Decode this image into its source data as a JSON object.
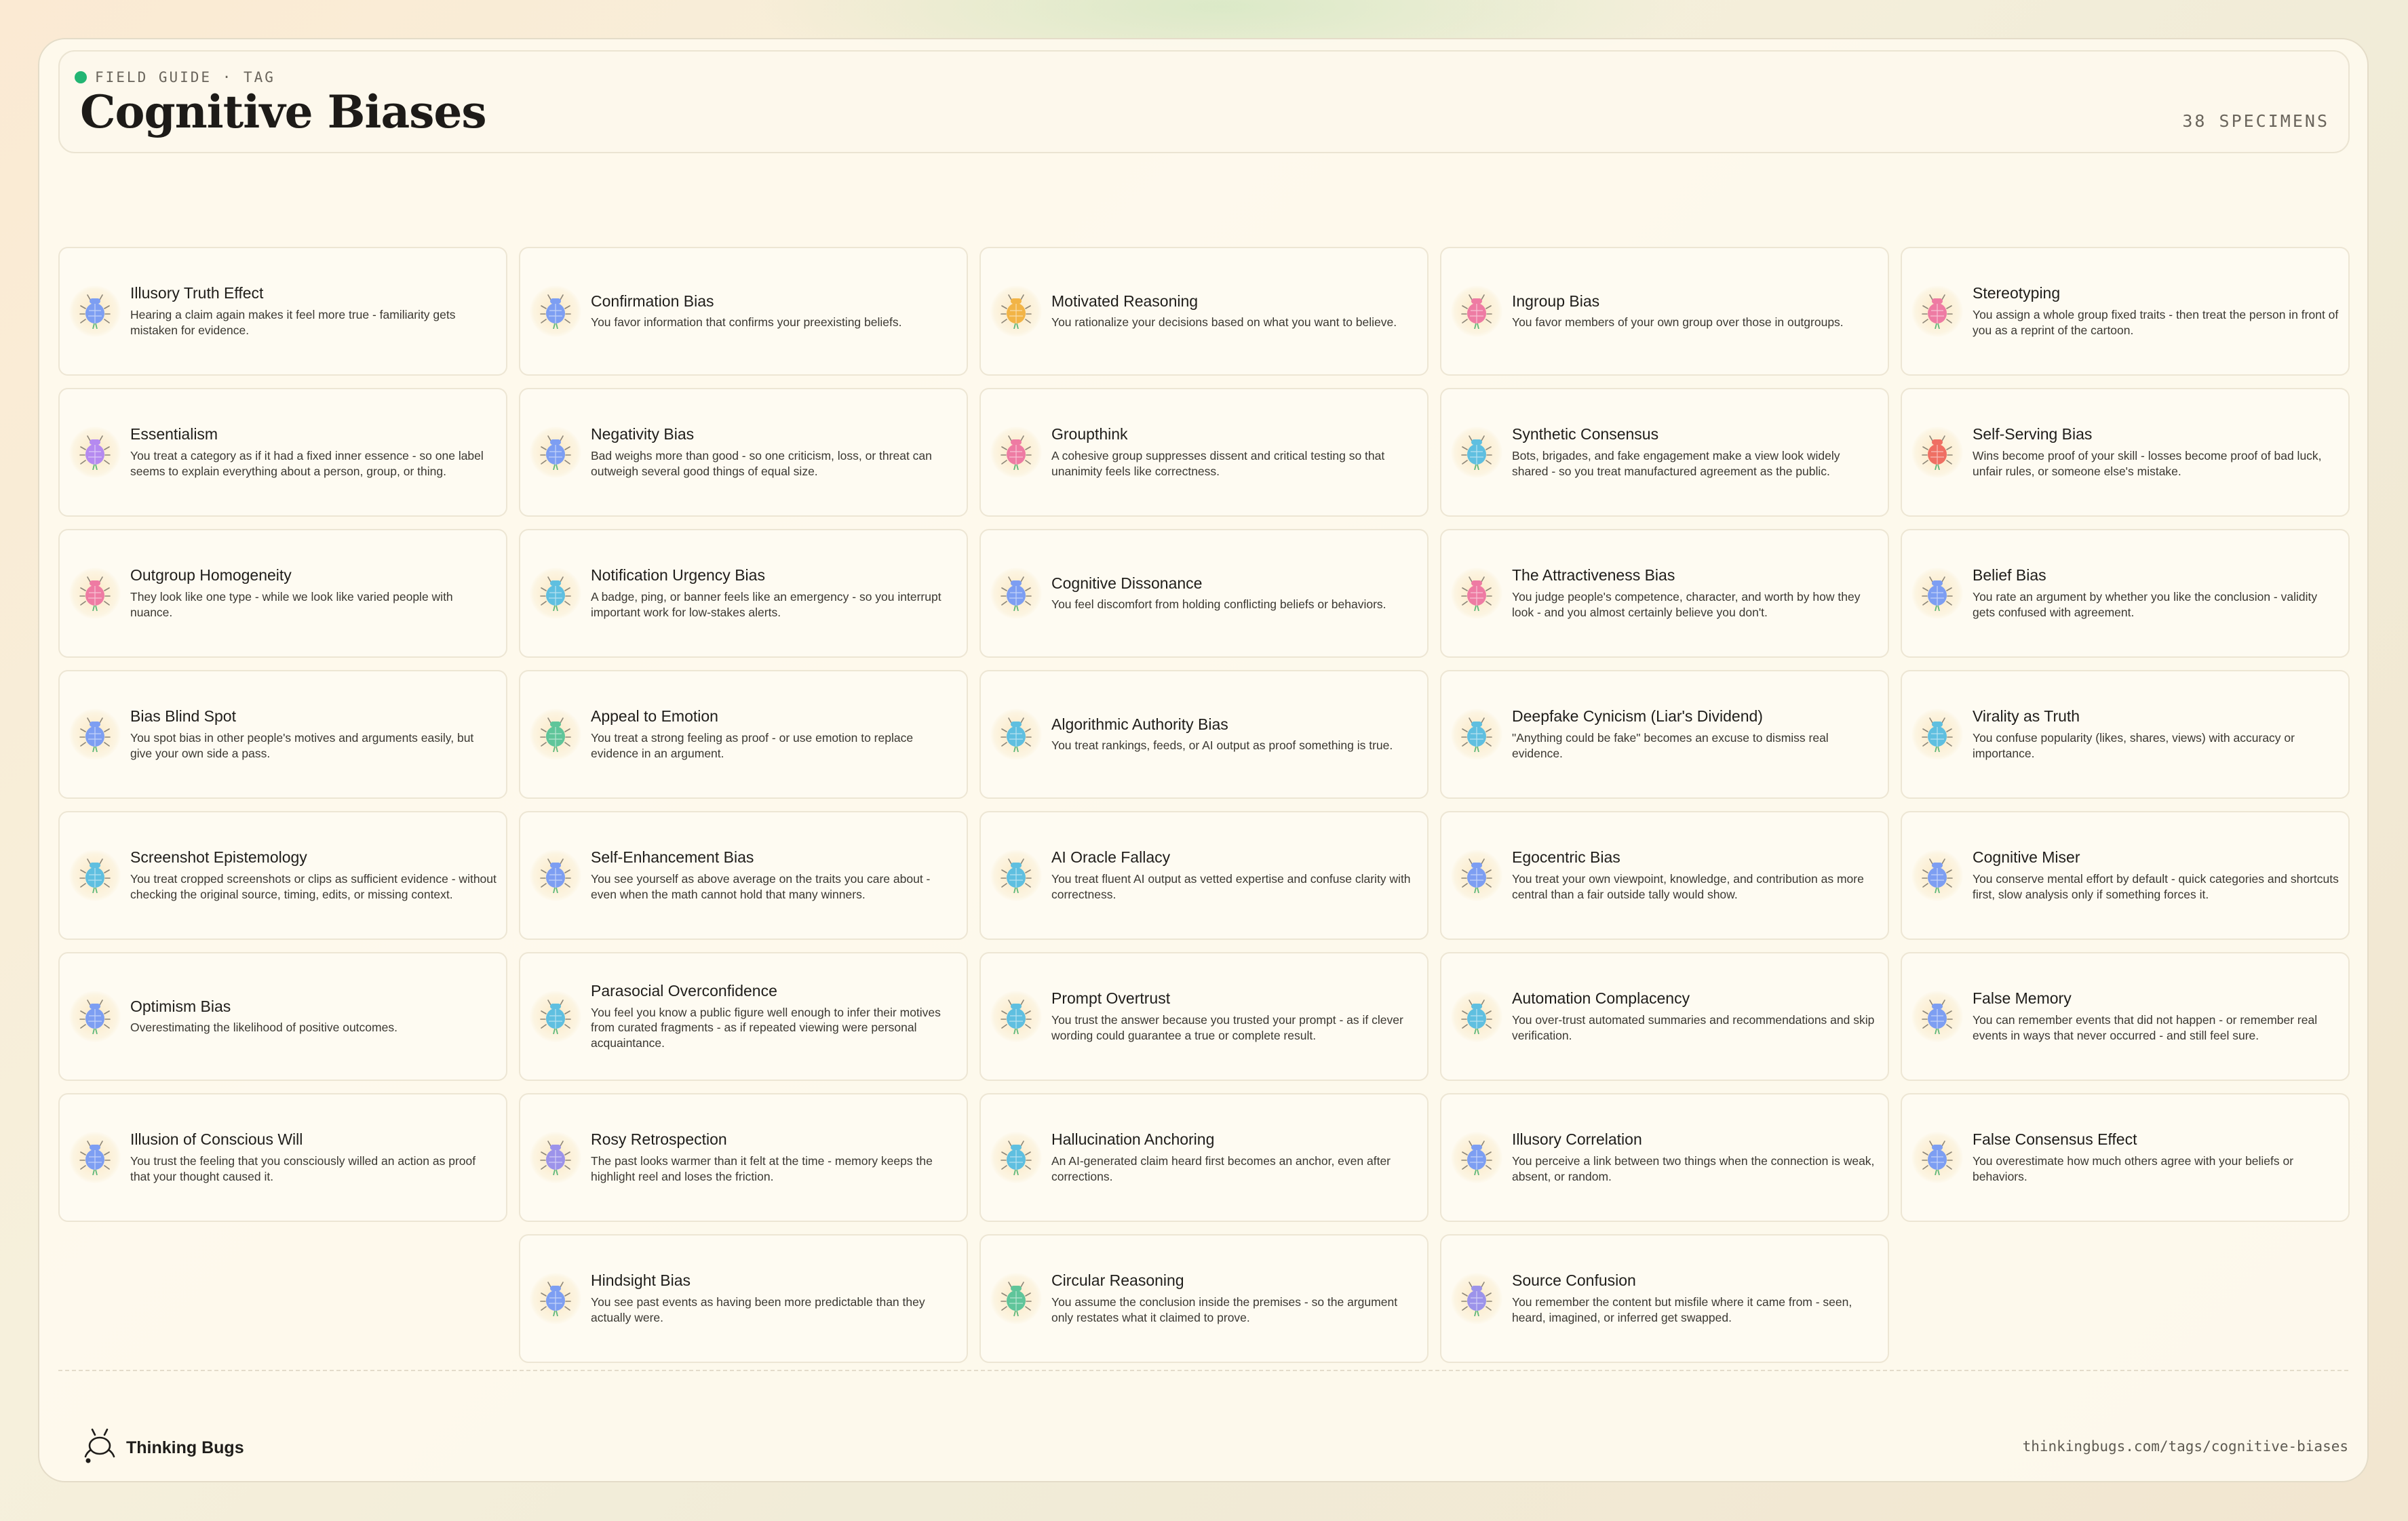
{
  "header": {
    "eyebrow": "FIELD GUIDE · TAG",
    "title": "Cognitive Biases",
    "count": "38 SPECIMENS"
  },
  "icons": {
    "status-dot": "green-dot-icon",
    "bug": "bug-icon",
    "logo": "bug-logo-icon"
  },
  "colors": {
    "status_dot": "#22b573",
    "bug_palette": {
      "blue": "#7d9ef2",
      "orange": "#f2b446",
      "pink": "#ee7ba3",
      "purple": "#b58af0",
      "cyan": "#5fbfe0",
      "red": "#ef6f63",
      "green": "#5fc59a",
      "violet": "#9c93ea"
    }
  },
  "cards": [
    {
      "title": "Illusory Truth Effect",
      "desc": "Hearing a claim again makes it feel more true - familiarity gets mistaken for evidence.",
      "color": "blue"
    },
    {
      "title": "Confirmation Bias",
      "desc": "You favor information that confirms your preexisting beliefs.",
      "color": "blue"
    },
    {
      "title": "Motivated Reasoning",
      "desc": "You rationalize your decisions based on what you want to believe.",
      "color": "orange"
    },
    {
      "title": "Ingroup Bias",
      "desc": "You favor members of your own group over those in outgroups.",
      "color": "pink"
    },
    {
      "title": "Stereotyping",
      "desc": "You assign a whole group fixed traits - then treat the person in front of you as a reprint of the cartoon.",
      "color": "pink"
    },
    {
      "title": "Essentialism",
      "desc": "You treat a category as if it had a fixed inner essence - so one label seems to explain everything about a person, group, or thing.",
      "color": "purple"
    },
    {
      "title": "Negativity Bias",
      "desc": "Bad weighs more than good - so one criticism, loss, or threat can outweigh several good things of equal size.",
      "color": "blue"
    },
    {
      "title": "Groupthink",
      "desc": "A cohesive group suppresses dissent and critical testing so that unanimity feels like correctness.",
      "color": "pink"
    },
    {
      "title": "Synthetic Consensus",
      "desc": "Bots, brigades, and fake engagement make a view look widely shared - so you treat manufactured agreement as the public.",
      "color": "cyan"
    },
    {
      "title": "Self-Serving Bias",
      "desc": "Wins become proof of your skill - losses become proof of bad luck, unfair rules, or someone else's mistake.",
      "color": "red"
    },
    {
      "title": "Outgroup Homogeneity",
      "desc": "They look like one type - while we look like varied people with nuance.",
      "color": "pink"
    },
    {
      "title": "Notification Urgency Bias",
      "desc": "A badge, ping, or banner feels like an emergency - so you interrupt important work for low-stakes alerts.",
      "color": "cyan"
    },
    {
      "title": "Cognitive Dissonance",
      "desc": "You feel discomfort from holding conflicting beliefs or behaviors.",
      "color": "blue"
    },
    {
      "title": "The Attractiveness Bias",
      "desc": "You judge people's competence, character, and worth by how they look - and you almost certainly believe you don't.",
      "color": "pink"
    },
    {
      "title": "Belief Bias",
      "desc": "You rate an argument by whether you like the conclusion - validity gets confused with agreement.",
      "color": "blue"
    },
    {
      "title": "Bias Blind Spot",
      "desc": "You spot bias in other people's motives and arguments easily, but give your own side a pass.",
      "color": "blue"
    },
    {
      "title": "Appeal to Emotion",
      "desc": "You treat a strong feeling as proof - or use emotion to replace evidence in an argument.",
      "color": "green"
    },
    {
      "title": "Algorithmic Authority Bias",
      "desc": "You treat rankings, feeds, or AI output as proof something is true.",
      "color": "cyan"
    },
    {
      "title": "Deepfake Cynicism (Liar's Dividend)",
      "desc": "\"Anything could be fake\" becomes an excuse to dismiss real evidence.",
      "color": "cyan"
    },
    {
      "title": "Virality as Truth",
      "desc": "You confuse popularity (likes, shares, views) with accuracy or importance.",
      "color": "cyan"
    },
    {
      "title": "Screenshot Epistemology",
      "desc": "You treat cropped screenshots or clips as sufficient evidence - without checking the original source, timing, edits, or missing context.",
      "color": "cyan"
    },
    {
      "title": "Self-Enhancement Bias",
      "desc": "You see yourself as above average on the traits you care about - even when the math cannot hold that many winners.",
      "color": "blue"
    },
    {
      "title": "AI Oracle Fallacy",
      "desc": "You treat fluent AI output as vetted expertise and confuse clarity with correctness.",
      "color": "cyan"
    },
    {
      "title": "Egocentric Bias",
      "desc": "You treat your own viewpoint, knowledge, and contribution as more central than a fair outside tally would show.",
      "color": "blue"
    },
    {
      "title": "Cognitive Miser",
      "desc": "You conserve mental effort by default - quick categories and shortcuts first, slow analysis only if something forces it.",
      "color": "blue"
    },
    {
      "title": "Optimism Bias",
      "desc": "Overestimating the likelihood of positive outcomes.",
      "color": "blue"
    },
    {
      "title": "Parasocial Overconfidence",
      "desc": "You feel you know a public figure well enough to infer their motives from curated fragments - as if repeated viewing were personal acquaintance.",
      "color": "cyan"
    },
    {
      "title": "Prompt Overtrust",
      "desc": "You trust the answer because you trusted your prompt - as if clever wording could guarantee a true or complete result.",
      "color": "cyan"
    },
    {
      "title": "Automation Complacency",
      "desc": "You over-trust automated summaries and recommendations and skip verification.",
      "color": "cyan"
    },
    {
      "title": "False Memory",
      "desc": "You can remember events that did not happen - or remember real events in ways that never occurred - and still feel sure.",
      "color": "blue"
    },
    {
      "title": "Illusion of Conscious Will",
      "desc": "You trust the feeling that you consciously willed an action as proof that your thought caused it.",
      "color": "blue"
    },
    {
      "title": "Rosy Retrospection",
      "desc": "The past looks warmer than it felt at the time - memory keeps the highlight reel and loses the friction.",
      "color": "violet"
    },
    {
      "title": "Hallucination Anchoring",
      "desc": "An AI-generated claim heard first becomes an anchor, even after corrections.",
      "color": "cyan"
    },
    {
      "title": "Illusory Correlation",
      "desc": "You perceive a link between two things when the connection is weak, absent, or random.",
      "color": "blue"
    },
    {
      "title": "False Consensus Effect",
      "desc": "You overestimate how much others agree with your beliefs or behaviors.",
      "color": "blue"
    },
    {
      "title": "Hindsight Bias",
      "desc": "You see past events as having been more predictable than they actually were.",
      "color": "blue"
    },
    {
      "title": "Circular Reasoning",
      "desc": "You assume the conclusion inside the premises - so the argument only restates what it claimed to prove.",
      "color": "green"
    },
    {
      "title": "Source Confusion",
      "desc": "You remember the content but misfile where it came from - seen, heard, imagined, or inferred get swapped.",
      "color": "violet"
    }
  ],
  "footer": {
    "brand": "Thinking Bugs",
    "url": "thinkingbugs.com/tags/cognitive-biases"
  }
}
